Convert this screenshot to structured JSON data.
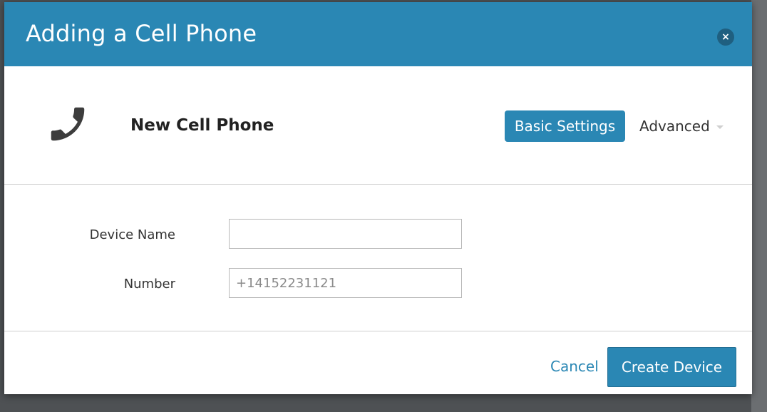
{
  "modal": {
    "title": "Adding a Cell Phone",
    "close_label": "×"
  },
  "device": {
    "icon": "phone-icon",
    "title": "New Cell Phone"
  },
  "tabs": {
    "basic_label": "Basic Settings",
    "advanced_label": "Advanced"
  },
  "form": {
    "device_name_label": "Device Name",
    "device_name_value": "",
    "device_name_placeholder": "",
    "number_label": "Number",
    "number_value": "",
    "number_placeholder": "+14152231121"
  },
  "footer": {
    "cancel_label": "Cancel",
    "create_label": "Create Device"
  },
  "colors": {
    "accent": "#2a87b4",
    "close_button": "#1f5f80"
  }
}
